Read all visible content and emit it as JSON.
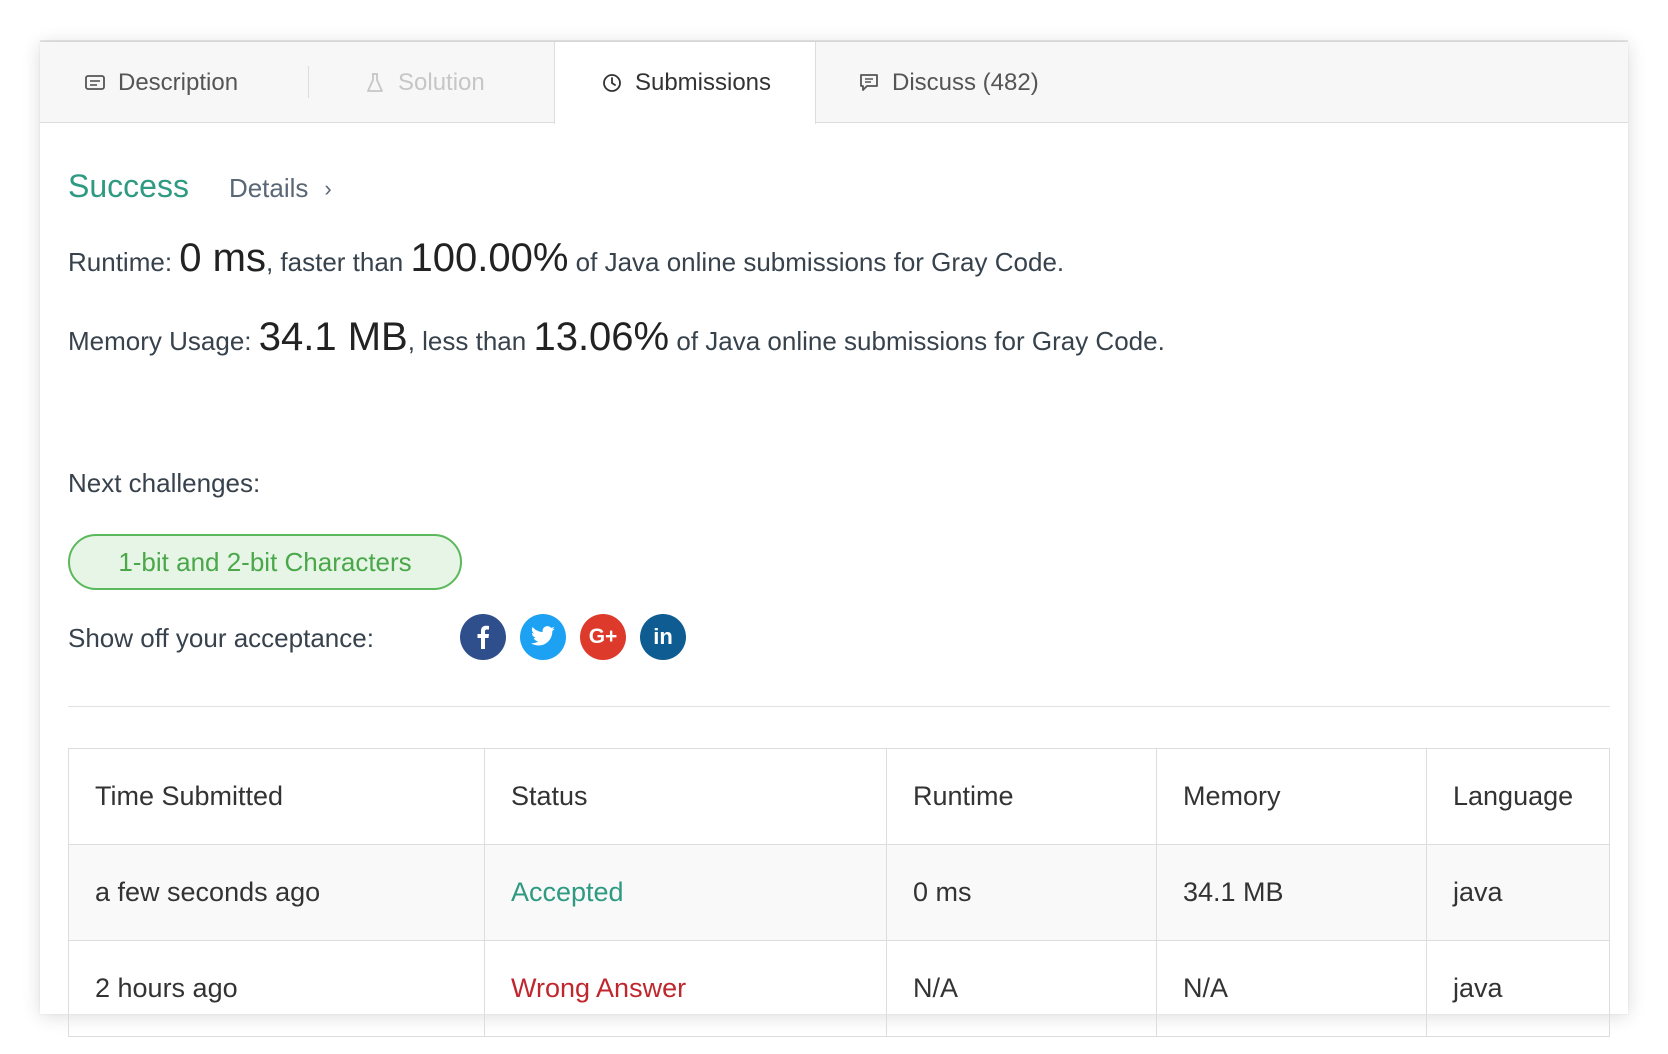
{
  "tabs": [
    {
      "label": "Description",
      "icon": "description-icon"
    },
    {
      "label": "Solution",
      "icon": "flask-icon"
    },
    {
      "label": "Submissions",
      "icon": "clock-icon"
    },
    {
      "label": "Discuss (482)",
      "icon": "chat-icon"
    }
  ],
  "result": {
    "status": "Success",
    "details_label": "Details"
  },
  "runtime": {
    "label": "Runtime:",
    "value": "0 ms",
    "comparison": ", faster than",
    "percent": "100.00%",
    "suffix": "of Java online submissions for Gray Code."
  },
  "memory": {
    "label": "Memory Usage:",
    "value": "34.1 MB",
    "comparison": ", less than",
    "percent": "13.06%",
    "suffix": "of Java online submissions for Gray Code."
  },
  "next_challenges": {
    "label": "Next challenges:",
    "items": [
      "1-bit and 2-bit Characters"
    ]
  },
  "share": {
    "label": "Show off your acceptance:",
    "networks": [
      {
        "name": "facebook",
        "glyph": "f",
        "color": "#2f4f8c"
      },
      {
        "name": "twitter",
        "glyph": "t",
        "color": "#1da1f2"
      },
      {
        "name": "google-plus",
        "glyph": "G+",
        "color": "#dd3a2b"
      },
      {
        "name": "linkedin",
        "glyph": "in",
        "color": "#0e5c91"
      }
    ]
  },
  "table": {
    "headers": [
      "Time Submitted",
      "Status",
      "Runtime",
      "Memory",
      "Language"
    ],
    "rows": [
      [
        "a few seconds ago",
        "Accepted",
        "0 ms",
        "34.1 MB",
        "java"
      ],
      [
        "2 hours ago",
        "Wrong Answer",
        "N/A",
        "N/A",
        "java"
      ]
    ]
  },
  "colors": {
    "success": "#2e9a82",
    "wrong": "#c0262d",
    "pill_border": "#5cb85c"
  }
}
